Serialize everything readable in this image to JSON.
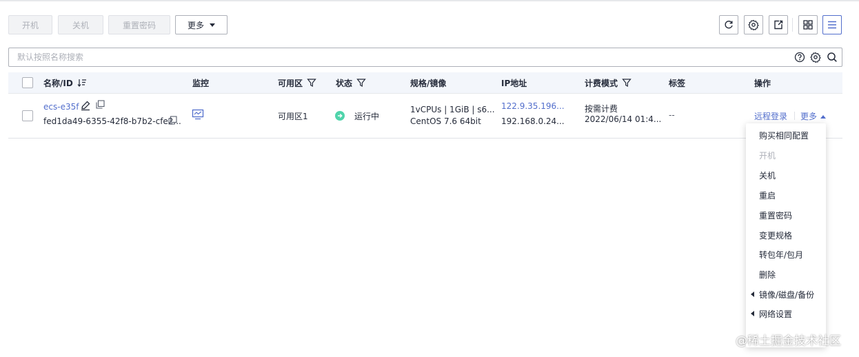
{
  "toolbar": {
    "start_label": "开机",
    "stop_label": "关机",
    "reset_password_label": "重置密码",
    "more_label": "更多"
  },
  "search": {
    "placeholder": "默认按照名称搜索"
  },
  "table": {
    "headers": {
      "name_id": "名称/ID",
      "monitor": "监控",
      "zone": "可用区",
      "status": "状态",
      "spec_image": "规格/镜像",
      "ip": "IP地址",
      "billing": "计费模式",
      "tags": "标签",
      "actions": "操作"
    },
    "rows": [
      {
        "name": "ecs-e35f",
        "id": "fed1da49-6355-42f8-b7b2-cfe2...",
        "zone": "可用区1",
        "status": "运行中",
        "spec": "1vCPUs | 1GiB | s6...",
        "image": "CentOS 7.6 64bit",
        "public_ip": "122.9.35.196...",
        "private_ip": "192.168.0.24...",
        "billing_mode": "按需计费",
        "billing_time": "2022/06/14 01:4...",
        "tags": "--",
        "remote_login": "远程登录",
        "more": "更多"
      }
    ]
  },
  "more_menu": {
    "items": [
      "购买相同配置",
      "开机",
      "关机",
      "重启",
      "重置密码",
      "变更规格",
      "转包年/包月",
      "删除",
      "镜像/磁盘/备份",
      "网络设置"
    ],
    "disabled": [
      "开机"
    ]
  },
  "watermark": "@稀土掘金技术社区",
  "colors": {
    "accent": "#526ecc",
    "running": "#50d4ab",
    "header_bg": "#f3f6fb",
    "disabled_text": "#adb0b8"
  }
}
